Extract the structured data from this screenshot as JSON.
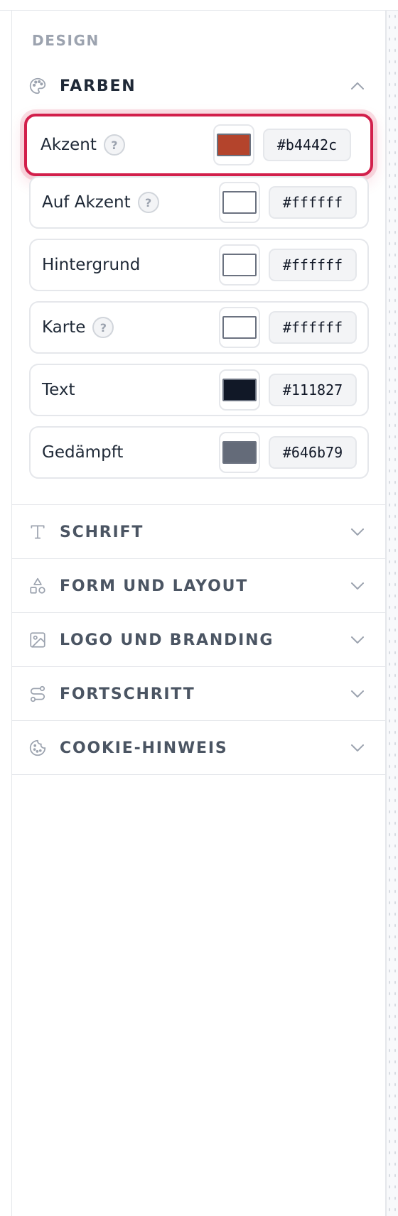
{
  "section_label": "DESIGN",
  "groups": {
    "farben": {
      "title": "FARBEN",
      "icon": "palette-icon",
      "expanded": true
    },
    "schrift": {
      "title": "SCHRIFT",
      "icon": "type-icon",
      "expanded": false
    },
    "form": {
      "title": "FORM UND LAYOUT",
      "icon": "shapes-icon",
      "expanded": false
    },
    "logo": {
      "title": "LOGO UND BRANDING",
      "icon": "image-icon",
      "expanded": false
    },
    "fortschritt": {
      "title": "FORTSCHRITT",
      "icon": "route-icon",
      "expanded": false
    },
    "cookie": {
      "title": "COOKIE-HINWEIS",
      "icon": "cookie-icon",
      "expanded": false
    }
  },
  "colors": [
    {
      "label": "Akzent",
      "hex": "#b4442c",
      "swatch": "#b4442c",
      "help": "?",
      "active": true
    },
    {
      "label": "Auf Akzent",
      "hex": "#ffffff",
      "swatch": "#ffffff",
      "help": "?"
    },
    {
      "label": "Hintergrund",
      "hex": "#ffffff",
      "swatch": "#ffffff"
    },
    {
      "label": "Karte",
      "hex": "#ffffff",
      "swatch": "#ffffff",
      "help": "?"
    },
    {
      "label": "Text",
      "hex": "#111827",
      "swatch": "#111827"
    },
    {
      "label": "Gedämpft",
      "hex": "#646b79",
      "swatch": "#646b79"
    }
  ],
  "theme": {
    "focus_ring": "#d21f4b",
    "border": "#e5e7eb",
    "muted_text": "#9ca3af"
  }
}
